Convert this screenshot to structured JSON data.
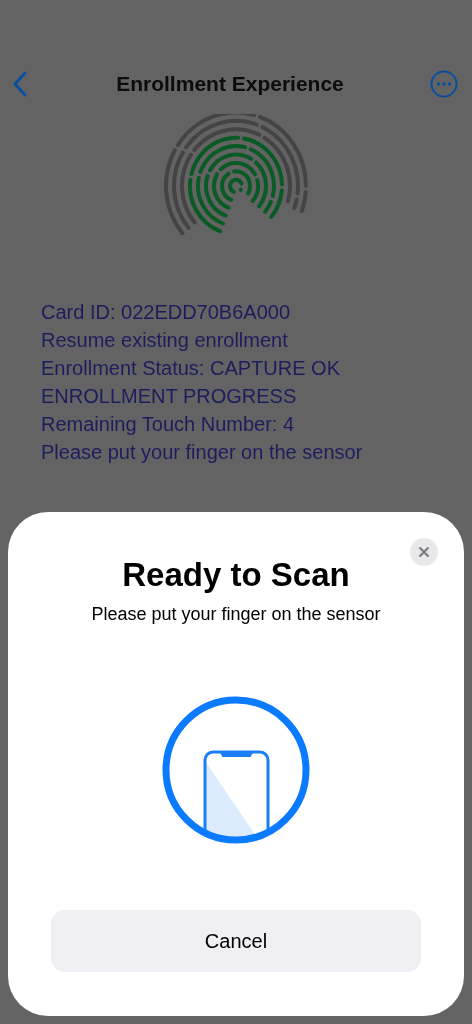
{
  "nav": {
    "title": "Enrollment Experience"
  },
  "info_lines": [
    "Card ID: 022EDD70B6A000",
    "Resume existing enrollment",
    "Enrollment Status: CAPTURE OK",
    "ENROLLMENT PROGRESS",
    "Remaining Touch Number: 4",
    "Please put your finger on the sensor"
  ],
  "sheet": {
    "title": "Ready to Scan",
    "message": "Please put your finger on the sensor",
    "button": "Cancel"
  }
}
